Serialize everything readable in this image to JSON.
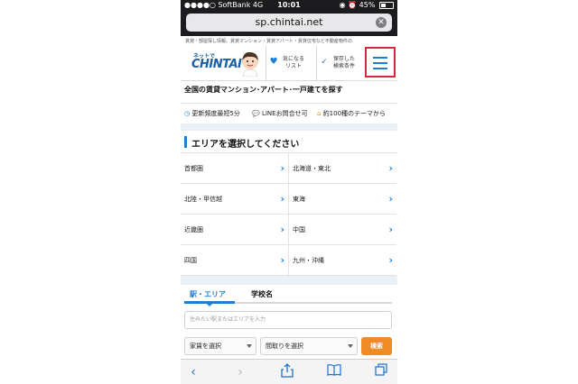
{
  "status": {
    "carrier": "SoftBank",
    "network": "4G",
    "time": "10:01",
    "battery": "45%"
  },
  "browser": {
    "url": "sp.chintai.net",
    "clear_icon": "close-icon"
  },
  "site": {
    "tagline": "賃貸・部屋探し情報。賃貸マンション・賃貸アパート・賃貸住宅など不動産物件の",
    "logo_small": "ネットで",
    "logo_main": "CHINTAI",
    "nav": {
      "favorites": "気になる\nリスト",
      "saved": "保存した\n検索条件",
      "menu_icon": "hamburger-menu-icon"
    }
  },
  "page": {
    "title_prefix": "全国",
    "title_rest": "の賃貸マンション･アパート･一戸建てを探す",
    "features": [
      "更新頻度最短5分",
      "LINEお問合せ可",
      "約100種のテーマから"
    ]
  },
  "area": {
    "heading": "エリアを選択してください",
    "items": [
      {
        "label": "首都圏"
      },
      {
        "label": "北海道・東北"
      },
      {
        "label": "北陸・甲信越"
      },
      {
        "label": "東海"
      },
      {
        "label": "近畿圏"
      },
      {
        "label": "中国"
      },
      {
        "label": "四国"
      },
      {
        "label": "九州・沖縄"
      }
    ]
  },
  "search": {
    "tabs": [
      {
        "label": "駅・エリア",
        "active": true
      },
      {
        "label": "学校名",
        "active": false
      }
    ],
    "placeholder": "住みたい駅またはエリアを入力",
    "rent_select": "家賃を選択",
    "layout_select": "間取りを選択",
    "button": "検索"
  },
  "colors": {
    "accent": "#1e7fd0",
    "highlight": "#d7263d",
    "search_button": "#f08a24"
  }
}
